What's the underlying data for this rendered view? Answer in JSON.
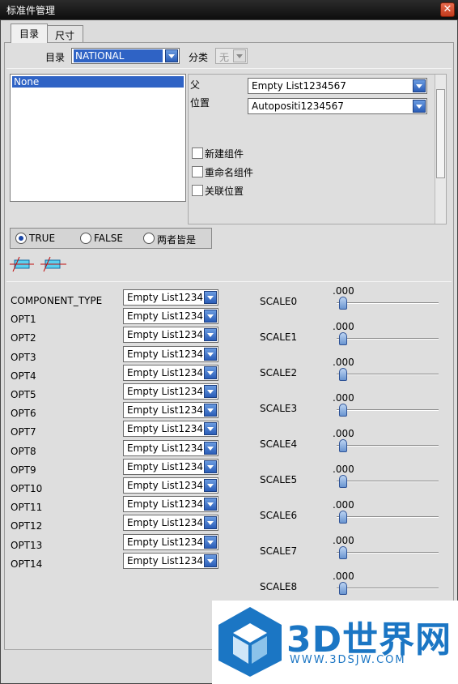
{
  "window": {
    "title": "标准件管理",
    "close_glyph": "✕"
  },
  "tabs": [
    {
      "label": "目录"
    },
    {
      "label": "尺寸"
    }
  ],
  "catalog": {
    "label": "目录",
    "value": "NATIONAL",
    "category_label": "分类",
    "category_value": "无"
  },
  "list": {
    "items": [
      "None"
    ]
  },
  "assembly": {
    "parent_label": "父",
    "parent_value": "Empty List1234567",
    "position_label": "位置",
    "position_value": "Autopositi1234567",
    "checkboxes": [
      "新建组件",
      "重命名组件",
      "关联位置"
    ]
  },
  "radios": {
    "options": [
      "TRUE",
      "FALSE",
      "两者皆是"
    ],
    "selected": "TRUE"
  },
  "params": [
    {
      "label": "COMPONENT_TYPE",
      "value": "Empty List1234"
    },
    {
      "label": "OPT1",
      "value": "Empty List1234"
    },
    {
      "label": "OPT2",
      "value": "Empty List1234"
    },
    {
      "label": "OPT3",
      "value": "Empty List1234"
    },
    {
      "label": "OPT4",
      "value": "Empty List1234"
    },
    {
      "label": "OPT5",
      "value": "Empty List1234"
    },
    {
      "label": "OPT6",
      "value": "Empty List1234"
    },
    {
      "label": "OPT7",
      "value": "Empty List1234"
    },
    {
      "label": "OPT8",
      "value": "Empty List1234"
    },
    {
      "label": "OPT9",
      "value": "Empty List1234"
    },
    {
      "label": "OPT10",
      "value": "Empty List1234"
    },
    {
      "label": "OPT11",
      "value": "Empty List1234"
    },
    {
      "label": "OPT12",
      "value": "Empty List1234"
    },
    {
      "label": "OPT13",
      "value": "Empty List1234"
    },
    {
      "label": "OPT14",
      "value": "Empty List1234"
    }
  ],
  "scales": [
    {
      "label": "SCALE0",
      "value": ".000",
      "level": 0
    },
    {
      "label": "SCALE1",
      "value": ".000",
      "level": 0
    },
    {
      "label": "SCALE2",
      "value": ".000",
      "level": 0
    },
    {
      "label": "SCALE3",
      "value": ".000",
      "level": 0
    },
    {
      "label": "SCALE4",
      "value": ".000",
      "level": 0
    },
    {
      "label": "SCALE5",
      "value": ".000",
      "level": 0
    },
    {
      "label": "SCALE6",
      "value": ".000",
      "level": 0
    },
    {
      "label": "SCALE7",
      "value": ".000",
      "level": 0
    },
    {
      "label": "SCALE8",
      "value": ".000",
      "level": 0
    }
  ],
  "watermark": {
    "text": "3D世界网",
    "url": "WWW.3DSJW.COM"
  },
  "colors": {
    "selection": "#2f63c5",
    "accent": "#1b76c4"
  },
  "icons": [
    "pipe-align-icon",
    "pipe-align-icon"
  ]
}
